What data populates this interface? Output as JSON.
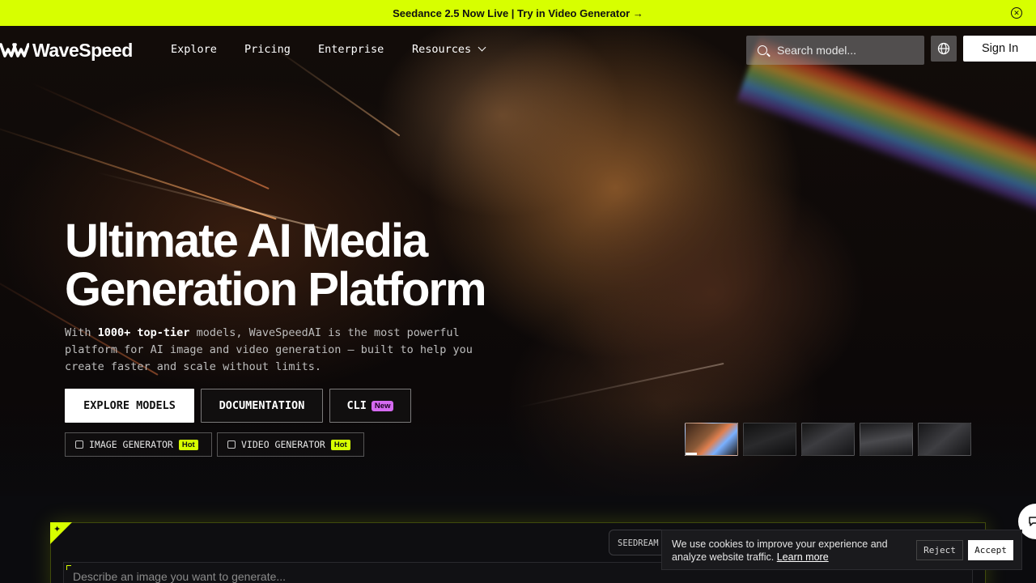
{
  "announcement": {
    "text": "Seedance 2.5 Now Live | Try in Video Generator →"
  },
  "brand": {
    "name": "WaveSpeed",
    "accent": "#d7ff00"
  },
  "nav": {
    "links": [
      {
        "label": "Explore"
      },
      {
        "label": "Pricing"
      },
      {
        "label": "Enterprise"
      },
      {
        "label": "Resources"
      }
    ],
    "search_placeholder": "Search model...",
    "signin_label": "Sign In"
  },
  "hero": {
    "title_line1": "Ultimate AI Media",
    "title_line2": "Generation Platform",
    "subtitle_prefix": "With ",
    "subtitle_bold": "1000+ top-tier",
    "subtitle_rest": " models, WaveSpeedAI is the most powerful platform for AI image and video generation — built to help you create faster and scale without limits.",
    "buttons": {
      "explore": "EXPLORE MODELS",
      "docs": "DOCUMENTATION",
      "cli": "CLI",
      "cli_badge": "New"
    },
    "chips": [
      {
        "label": "IMAGE GENERATOR",
        "badge": "Hot"
      },
      {
        "label": "VIDEO GENERATOR",
        "badge": "Hot"
      }
    ]
  },
  "generator": {
    "model_tag": "SEEDREAM",
    "prompt_placeholder": "Describe an image you want to generate..."
  },
  "cookie": {
    "text": "We use cookies to improve your experience and analyze website traffic.",
    "link": "Learn more",
    "reject": "Reject",
    "accept": "Accept"
  }
}
